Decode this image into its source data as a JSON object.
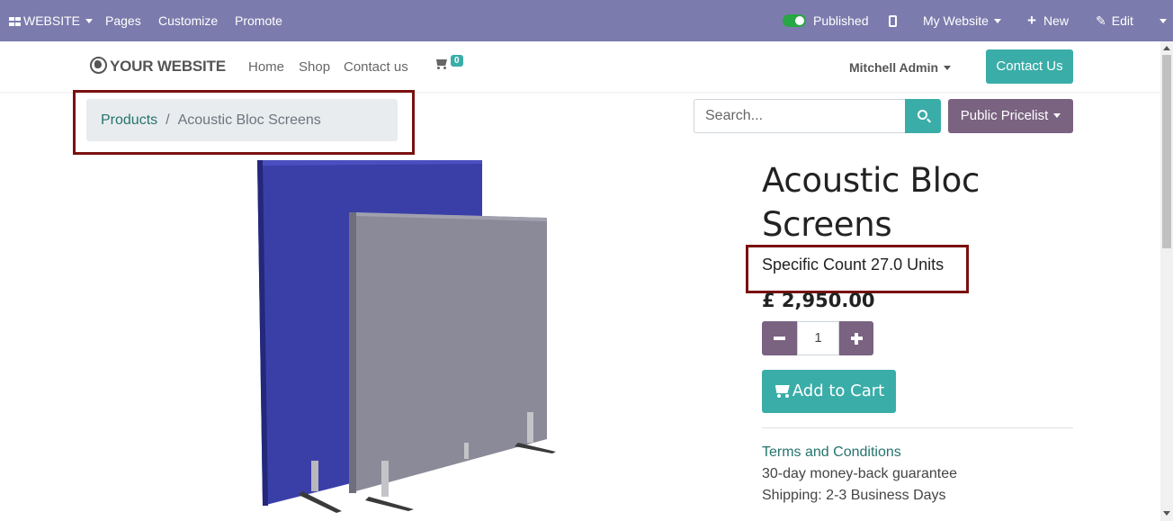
{
  "admin_bar": {
    "website_menu": "WEBSITE",
    "pages": "Pages",
    "customize": "Customize",
    "promote": "Promote",
    "published": "Published",
    "my_website": "My Website",
    "new": "New",
    "edit": "Edit"
  },
  "header": {
    "logo": "YOUR WEBSITE",
    "nav": [
      "Home",
      "Shop",
      "Contact us"
    ],
    "cart_count": "0",
    "user": "Mitchell Admin",
    "contact_button": "Contact Us"
  },
  "breadcrumb": {
    "parent": "Products",
    "separator": "/",
    "current": "Acoustic Bloc Screens"
  },
  "search": {
    "placeholder": "Search..."
  },
  "pricelist": {
    "label": "Public Pricelist"
  },
  "product": {
    "title": "Acoustic Bloc Screens",
    "specific_count": "Specific Count 27.0 Units",
    "price": "£ 2,950.00",
    "quantity": "1",
    "add_to_cart": "Add to Cart",
    "terms": "Terms and Conditions",
    "guarantee": "30-day money-back guarantee",
    "shipping": "Shipping: 2-3 Business Days"
  },
  "colors": {
    "admin_bar": "#7c7bad",
    "primary": "#3aada8",
    "secondary": "#7a6281",
    "highlight": "#7a1010"
  }
}
